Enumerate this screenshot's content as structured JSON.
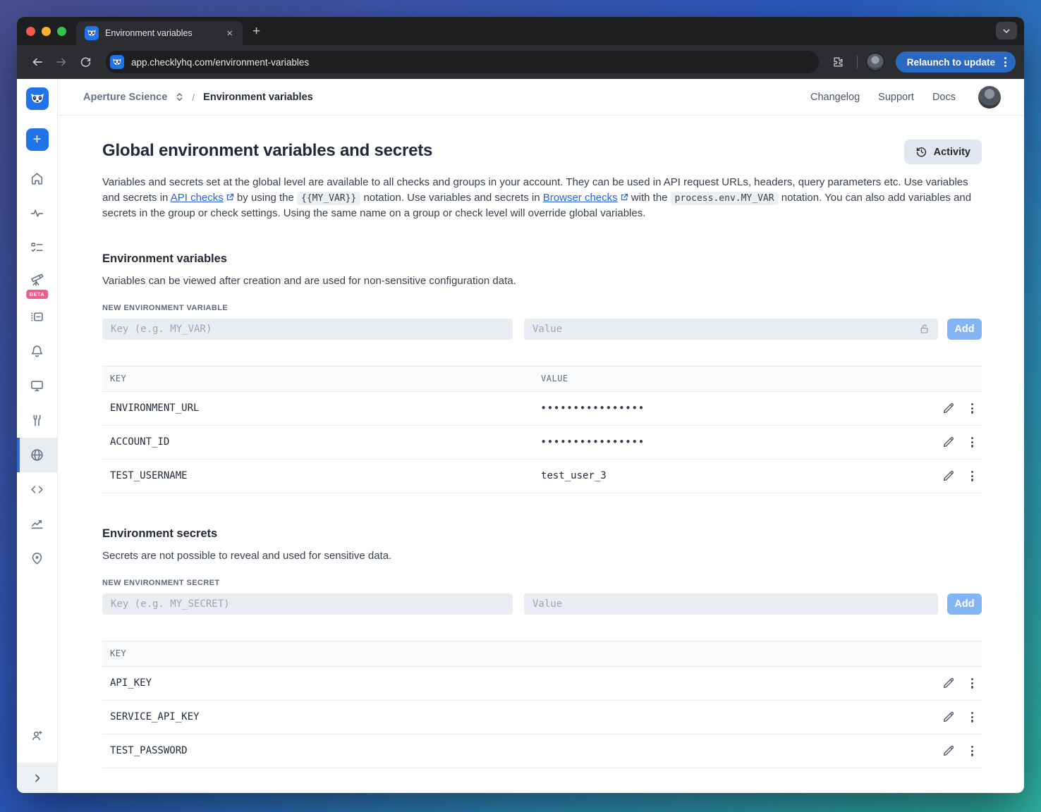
{
  "colors": {
    "accent_blue": "#2174e8",
    "link_blue": "#2563eb",
    "add_button_blue": "#83b4f3",
    "beta_pink": "#ee5d8d",
    "relaunch_blue": "#2a68c2",
    "active_item_bar": "#2f6ae0"
  },
  "browser": {
    "tab_title": "Environment variables",
    "url_domain": "app.checklyhq.com",
    "url_path": "/environment-variables",
    "relaunch_label": "Relaunch to update"
  },
  "topnav": {
    "account": "Aperture Science",
    "separator": "/",
    "current": "Environment variables",
    "links": [
      {
        "label": "Changelog"
      },
      {
        "label": "Support"
      },
      {
        "label": "Docs"
      }
    ]
  },
  "sidebar": {
    "beta_label": "BETA",
    "icons": [
      "checkly-logo",
      "create-new",
      "home",
      "activity-pulse",
      "checks-list",
      "telescope-beta",
      "runtimes-panel",
      "alerts-bell",
      "dashboards-monitor",
      "maintenance-wrench",
      "environment-globe",
      "cli-code",
      "analytics-chart",
      "locations-pin",
      "invite-user",
      "expand-sidebar"
    ],
    "active_icon": "environment-globe"
  },
  "page": {
    "title": "Global environment variables and secrets",
    "activity_button": "Activity",
    "intro": {
      "p1": "Variables and secrets set at the global level are available to all checks and groups in your account. They can be used in API request URLs, headers, query parameters etc. Use variables and secrets in ",
      "link1": "API checks",
      "p2": " by using the ",
      "code1": "{{MY_VAR}}",
      "p3": " notation. Use variables and secrets in ",
      "link2": "Browser checks",
      "p4": " with the ",
      "code2": "process.env.MY_VAR",
      "p5": " notation. You can also add variables and secrets in the group or check settings. Using the same name on a group or check level will override global variables."
    }
  },
  "variables": {
    "heading": "Environment variables",
    "description": "Variables can be viewed after creation and are used for non-sensitive configuration data.",
    "form_label": "NEW ENVIRONMENT VARIABLE",
    "key_placeholder": "Key (e.g. MY_VAR)",
    "value_placeholder": "Value",
    "add_button": "Add",
    "table": {
      "columns": [
        "KEY",
        "VALUE"
      ],
      "rows": [
        {
          "key": "ENVIRONMENT_URL",
          "value": "••••••••••••••••",
          "masked": true
        },
        {
          "key": "ACCOUNT_ID",
          "value": "••••••••••••••••",
          "masked": true
        },
        {
          "key": "TEST_USERNAME",
          "value": "test_user_3",
          "masked": false
        }
      ]
    }
  },
  "secrets": {
    "heading": "Environment secrets",
    "description": "Secrets are not possible to reveal and used for sensitive data.",
    "form_label": "NEW ENVIRONMENT SECRET",
    "key_placeholder": "Key (e.g. MY_SECRET)",
    "value_placeholder": "Value",
    "add_button": "Add",
    "table": {
      "columns": [
        "KEY"
      ],
      "rows": [
        {
          "key": "API_KEY"
        },
        {
          "key": "SERVICE_API_KEY"
        },
        {
          "key": "TEST_PASSWORD"
        }
      ]
    }
  }
}
